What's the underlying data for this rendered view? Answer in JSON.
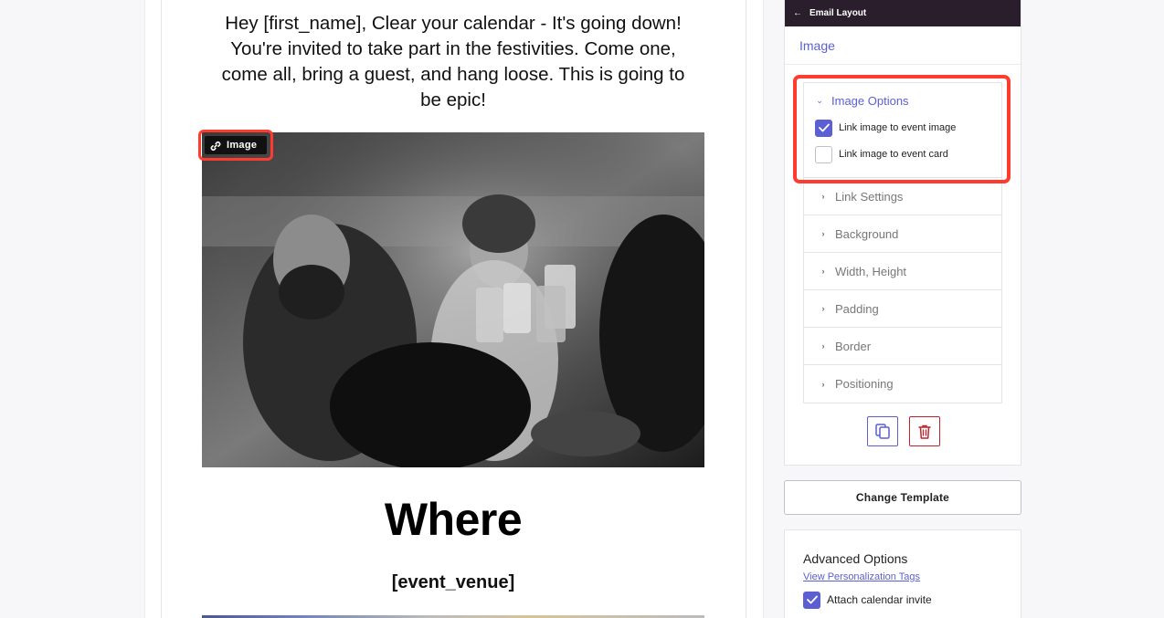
{
  "email": {
    "intro": "Hey [first_name], Clear your calendar - It's going down! You're invited to take part in the festivities. Come one, come all, bring a guest, and hang loose. This is going to be epic!",
    "image_tag_label": "Image",
    "where_heading": "Where",
    "venue": "[event_venue]"
  },
  "panel": {
    "header_title": "Email Layout",
    "section_title": "Image",
    "image_options": {
      "title": "Image Options",
      "options": [
        {
          "label": "Link image to event image",
          "checked": true
        },
        {
          "label": "Link image to event card",
          "checked": false
        }
      ]
    },
    "collapsed_sections": [
      "Link Settings",
      "Background",
      "Width, Height",
      "Padding",
      "Border",
      "Positioning"
    ]
  },
  "change_template_label": "Change Template",
  "advanced": {
    "title": "Advanced Options",
    "link": "View Personalization Tags",
    "attach_label": "Attach calendar invite",
    "attach_checked": true
  },
  "colors": {
    "accent": "#5b5fd1",
    "header_bg": "#2a1e2c",
    "highlight": "#ff3b30",
    "danger": "#c3222b"
  },
  "icons": {
    "back": "arrow-left-icon",
    "link": "link-icon",
    "copy": "copy-icon",
    "trash": "trash-icon",
    "checkmark": "checkmark-icon"
  }
}
